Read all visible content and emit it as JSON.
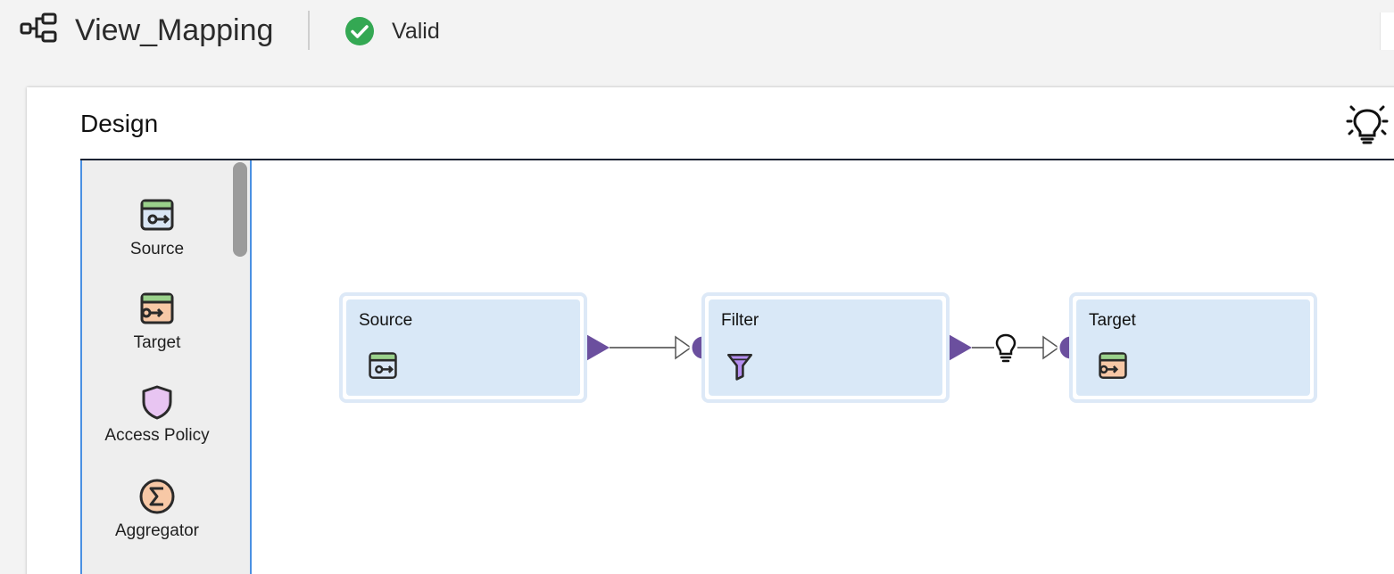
{
  "header": {
    "title": "View_Mapping",
    "status": "Valid",
    "status_color": "#34a853",
    "mapping_icon": "mapping-flow-icon",
    "status_icon": "check-circle-icon"
  },
  "design": {
    "title": "Design",
    "hint_icon": "lightbulb-icon"
  },
  "palette": {
    "items": [
      {
        "label": "Source",
        "icon": "source-icon"
      },
      {
        "label": "Target",
        "icon": "target-icon"
      },
      {
        "label": "Access Policy",
        "icon": "shield-icon"
      },
      {
        "label": "Aggregator",
        "icon": "sigma-icon"
      }
    ]
  },
  "canvas": {
    "nodes": [
      {
        "title": "Source",
        "icon": "source-icon"
      },
      {
        "title": "Filter",
        "icon": "funnel-icon"
      },
      {
        "title": "Target",
        "icon": "target-icon"
      }
    ],
    "link_icon": "lightbulb-icon",
    "port_color": "#6b4f9e"
  }
}
